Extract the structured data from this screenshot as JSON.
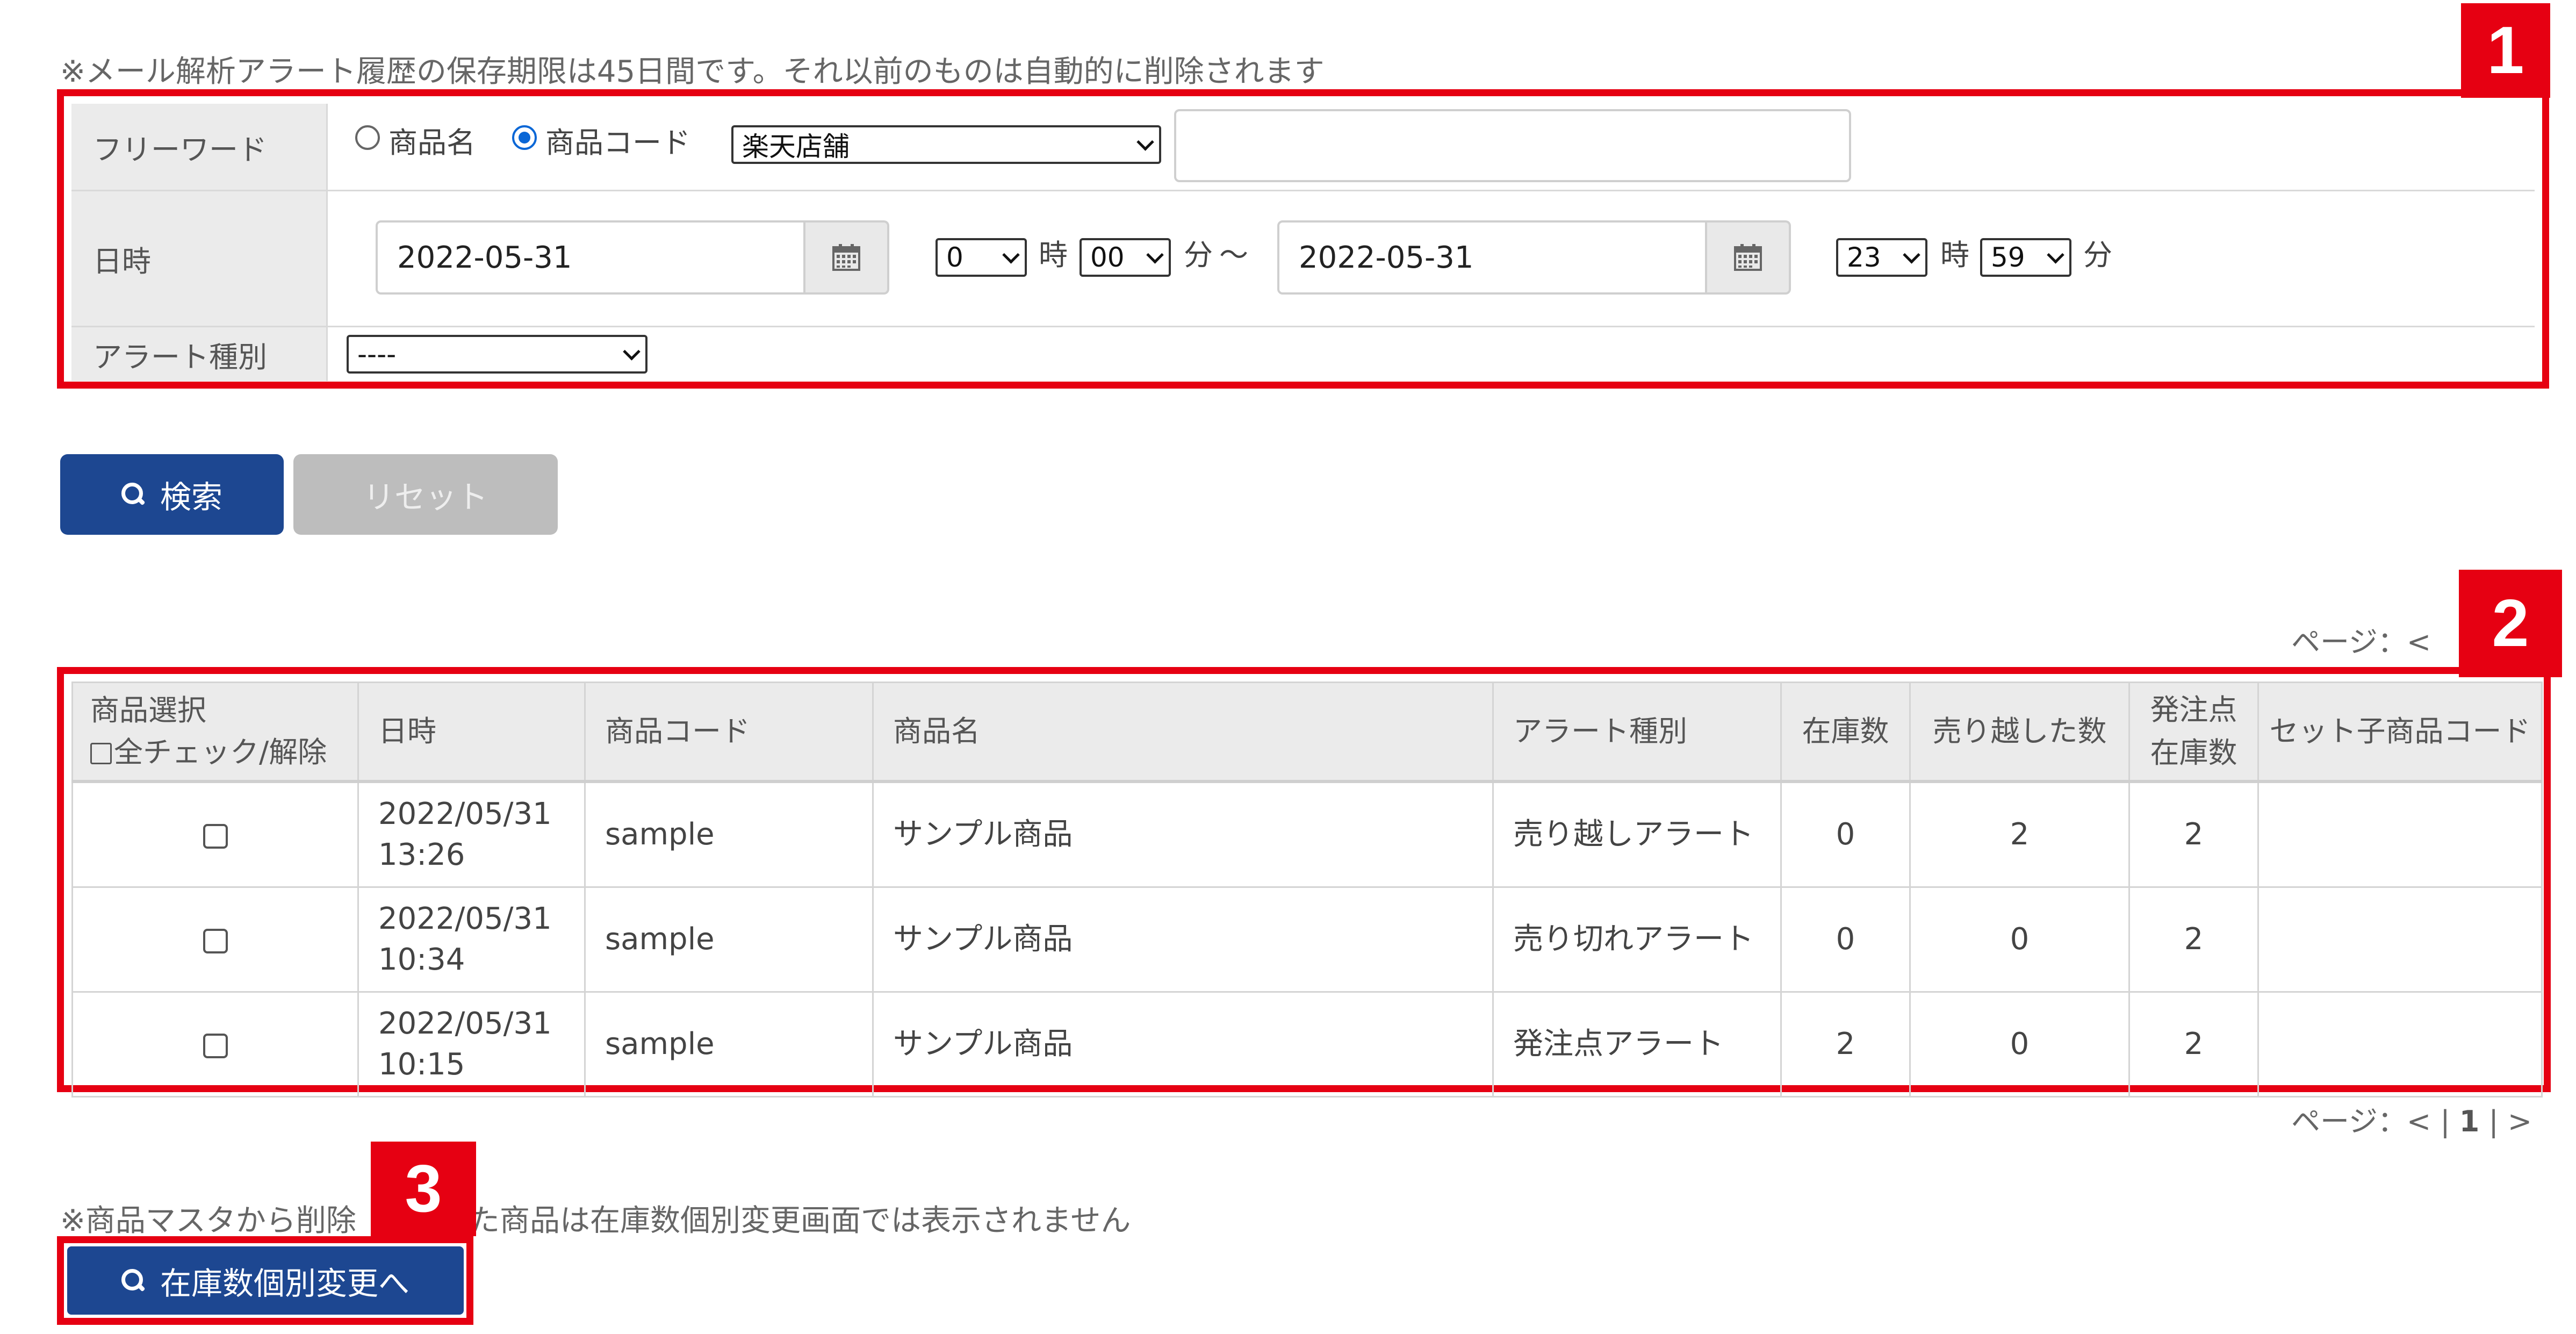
{
  "notes": {
    "retention": "※メール解析アラート履歴の保存期限は45日間です。それ以前のものは自動的に削除されます",
    "deleted_items": "※商品マスタから削除された商品は在庫数個別変更画面では表示されません",
    "deleted_items_prefix": "※商品マスタから削除",
    "deleted_items_suffix": "た商品は在庫数個別変更画面では表示されません"
  },
  "badges": {
    "b1": "1",
    "b2": "2",
    "b3": "3"
  },
  "search_form": {
    "freeword": {
      "label": "フリーワード",
      "radio_product_name": "商品名",
      "radio_product_code": "商品コード",
      "selected_radio": "商品コード",
      "store_select": "楽天店舗",
      "keyword_value": ""
    },
    "datetime": {
      "label": "日時",
      "from_date": "2022-05-31",
      "from_hour": "0",
      "hour_unit": "時",
      "from_minute": "00",
      "minute_unit": "分",
      "tilde": "～",
      "to_date": "2022-05-31",
      "to_hour": "23",
      "to_minute": "59"
    },
    "alert_type": {
      "label": "アラート種別",
      "select": "----"
    }
  },
  "buttons": {
    "search": "検索",
    "reset": "リセット",
    "stock_change": "在庫数個別変更へ"
  },
  "pager_top": {
    "label": "ページ：<"
  },
  "pager_bottom": {
    "label": "ページ：<",
    "current": "1",
    "sep": "|",
    "next": ">"
  },
  "table": {
    "headers": {
      "select_line1": "商品選択",
      "select_line2": "全チェック/解除",
      "datetime": "日時",
      "product_code": "商品コード",
      "product_name": "商品名",
      "alert_type": "アラート種別",
      "stock": "在庫数",
      "oversold": "売り越した数",
      "reorder_line1": "発注点",
      "reorder_line2": "在庫数",
      "set_child_code": "セット子商品コード"
    },
    "rows": [
      {
        "date": "2022/05/31",
        "time": "13:26",
        "code": "sample",
        "name": "サンプル商品",
        "alert": "売り越しアラート",
        "stock": "0",
        "oversold": "2",
        "reorder": "2",
        "set_child": ""
      },
      {
        "date": "2022/05/31",
        "time": "10:34",
        "code": "sample",
        "name": "サンプル商品",
        "alert": "売り切れアラート",
        "stock": "0",
        "oversold": "0",
        "reorder": "2",
        "set_child": ""
      },
      {
        "date": "2022/05/31",
        "time": "10:15",
        "code": "sample",
        "name": "サンプル商品",
        "alert": "発注点アラート",
        "stock": "2",
        "oversold": "0",
        "reorder": "2",
        "set_child": ""
      }
    ]
  }
}
